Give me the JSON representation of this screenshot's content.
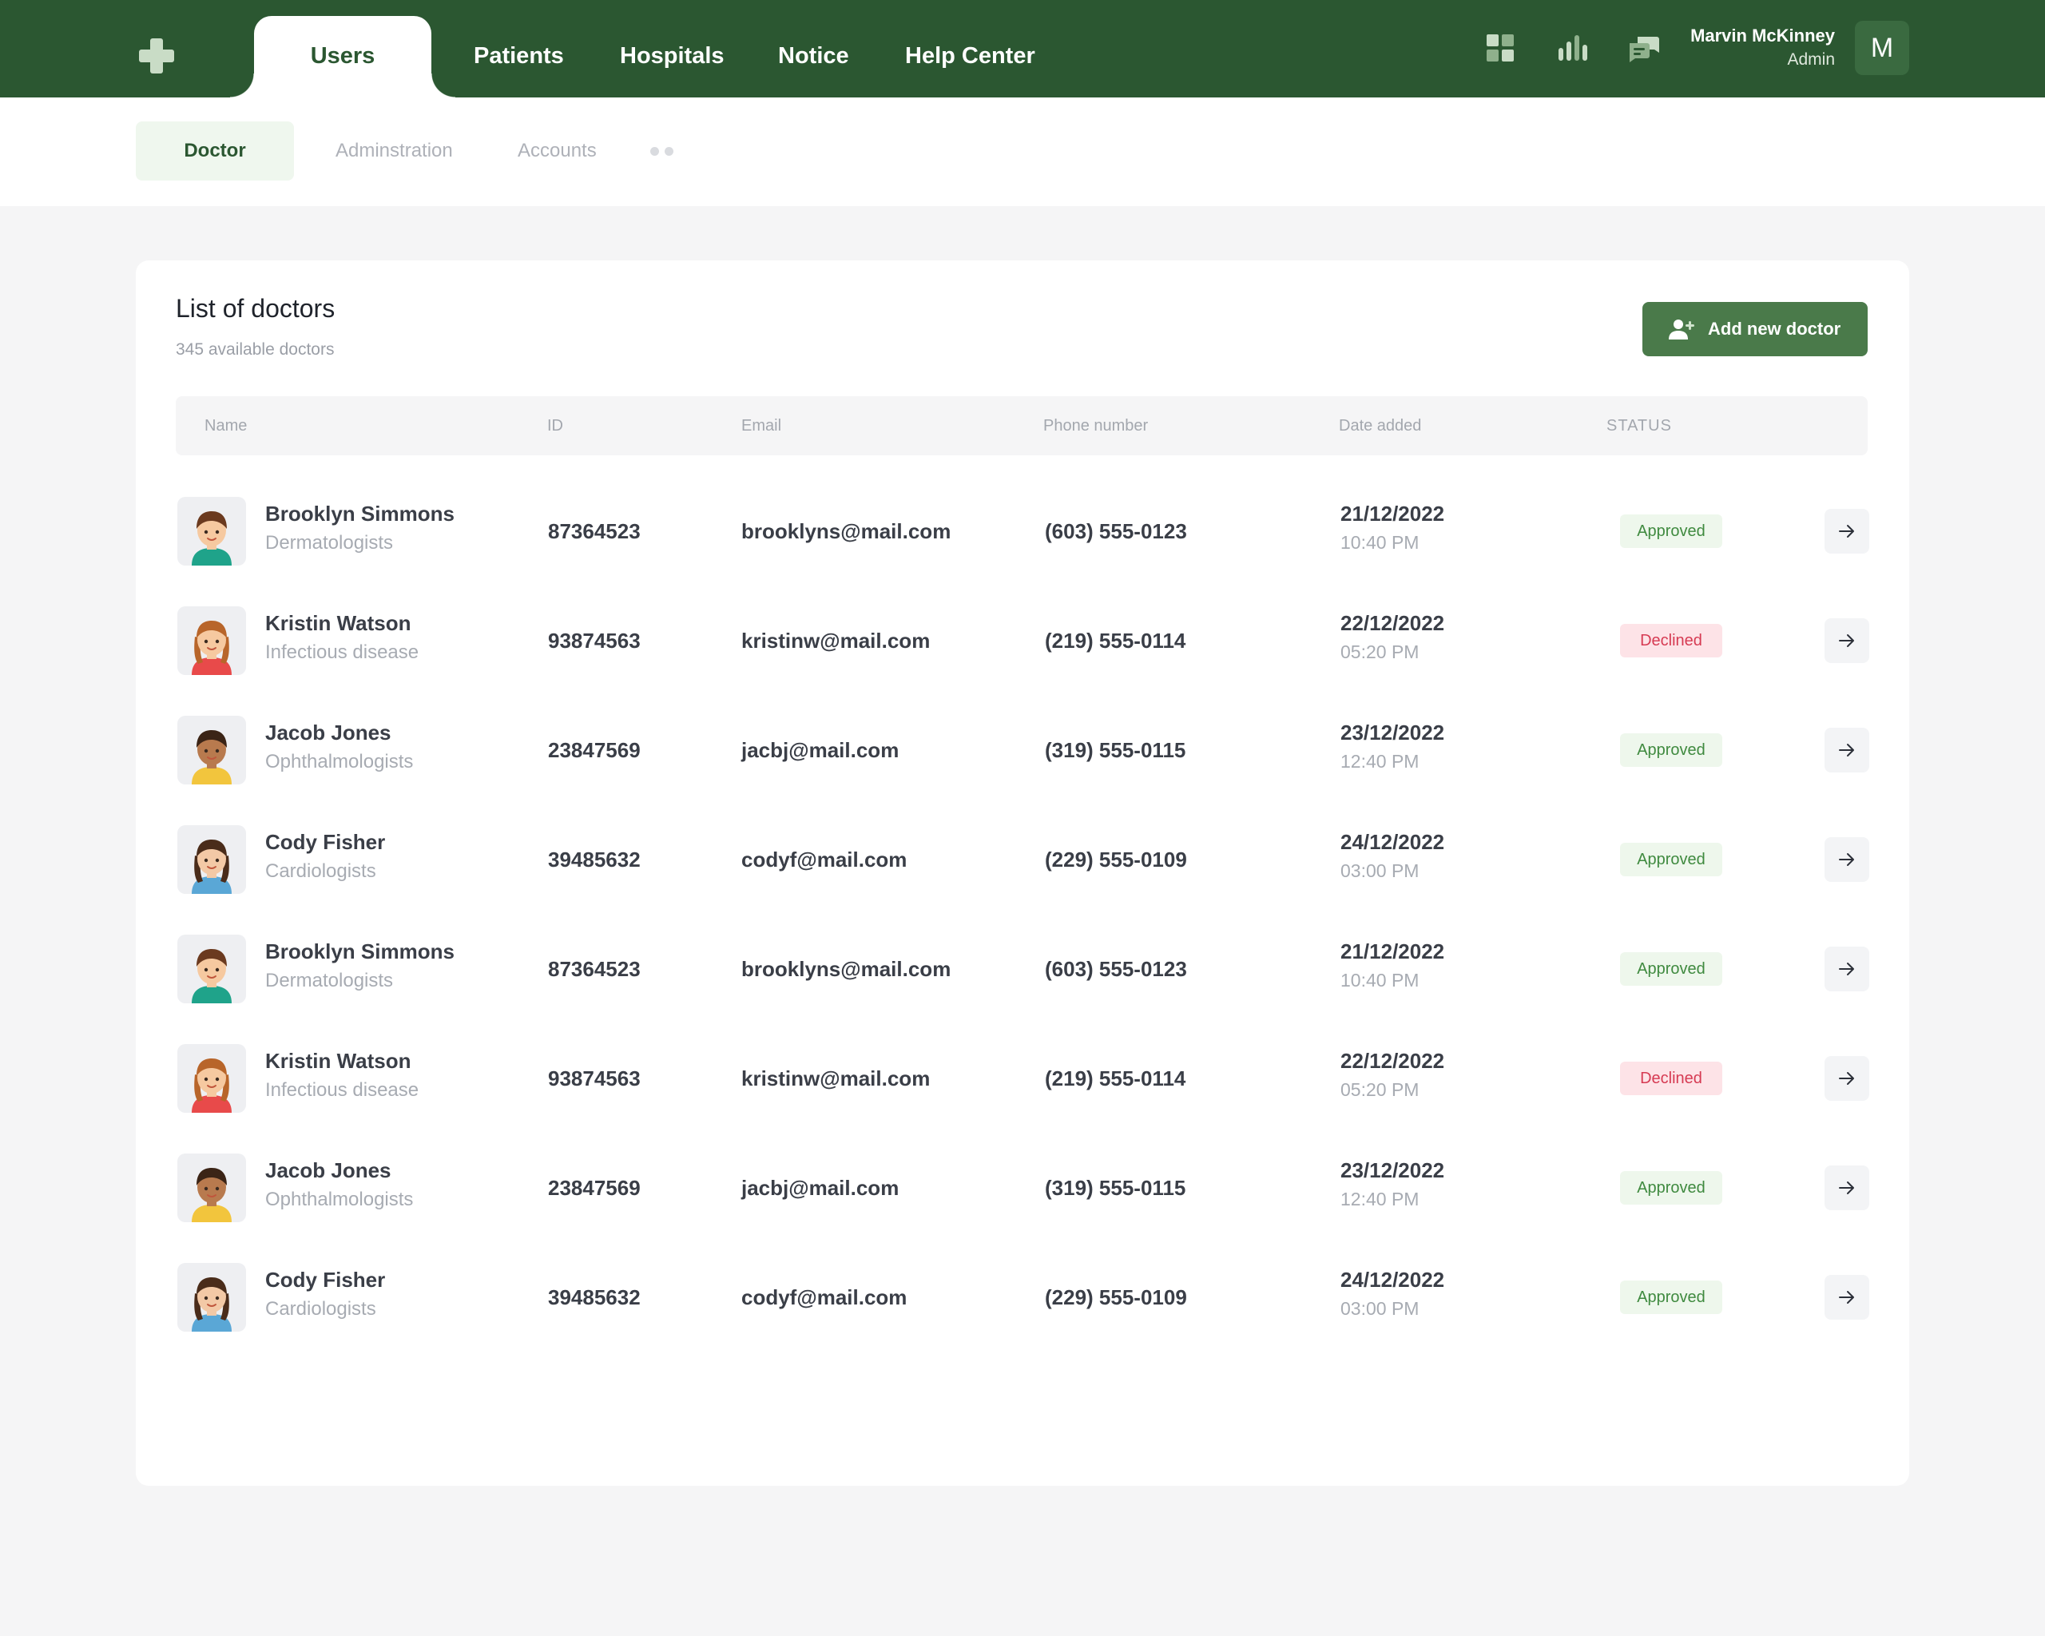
{
  "nav": {
    "tabs": [
      {
        "label": "Users",
        "active": true
      },
      {
        "label": "Patients"
      },
      {
        "label": "Hospitals"
      },
      {
        "label": "Notice"
      },
      {
        "label": "Help Center"
      }
    ],
    "icons": [
      "dashboard-icon",
      "bar-chart-icon",
      "chat-icon"
    ],
    "user": {
      "name": "Marvin McKinney",
      "role": "Admin",
      "initial": "M"
    }
  },
  "subnav": {
    "tabs": [
      {
        "label": "Doctor",
        "active": true
      },
      {
        "label": "Adminstration"
      },
      {
        "label": "Accounts"
      }
    ]
  },
  "card": {
    "title": "List of doctors",
    "subtitle": "345 available doctors",
    "add_button": "Add new doctor"
  },
  "table": {
    "headers": {
      "name": "Name",
      "id": "ID",
      "email": "Email",
      "phone": "Phone number",
      "date": "Date added",
      "status": "STATUS"
    },
    "rows": [
      {
        "name": "Brooklyn Simmons",
        "specialty": "Dermatologists",
        "id": "87364523",
        "email": "brooklyns@mail.com",
        "phone": "(603) 555-0123",
        "date": "21/12/2022",
        "time": "10:40 PM",
        "status": "Approved"
      },
      {
        "name": "Kristin Watson",
        "specialty": "Infectious disease",
        "id": "93874563",
        "email": "kristinw@mail.com",
        "phone": "(219) 555-0114",
        "date": "22/12/2022",
        "time": "05:20 PM",
        "status": "Declined"
      },
      {
        "name": "Jacob Jones",
        "specialty": "Ophthalmologists",
        "id": "23847569",
        "email": "jacbj@mail.com",
        "phone": "(319) 555-0115",
        "date": "23/12/2022",
        "time": "12:40 PM",
        "status": "Approved"
      },
      {
        "name": "Cody Fisher",
        "specialty": "Cardiologists",
        "id": "39485632",
        "email": "codyf@mail.com",
        "phone": "(229) 555-0109",
        "date": "24/12/2022",
        "time": "03:00 PM",
        "status": "Approved"
      },
      {
        "name": "Brooklyn Simmons",
        "specialty": "Dermatologists",
        "id": "87364523",
        "email": "brooklyns@mail.com",
        "phone": "(603) 555-0123",
        "date": "21/12/2022",
        "time": "10:40 PM",
        "status": "Approved"
      },
      {
        "name": "Kristin Watson",
        "specialty": "Infectious disease",
        "id": "93874563",
        "email": "kristinw@mail.com",
        "phone": "(219) 555-0114",
        "date": "22/12/2022",
        "time": "05:20 PM",
        "status": "Declined"
      },
      {
        "name": "Jacob Jones",
        "specialty": "Ophthalmologists",
        "id": "23847569",
        "email": "jacbj@mail.com",
        "phone": "(319) 555-0115",
        "date": "23/12/2022",
        "time": "12:40 PM",
        "status": "Approved"
      },
      {
        "name": "Cody Fisher",
        "specialty": "Cardiologists",
        "id": "39485632",
        "email": "codyf@mail.com",
        "phone": "(229) 555-0109",
        "date": "24/12/2022",
        "time": "03:00 PM",
        "status": "Approved"
      }
    ]
  },
  "colors": {
    "brand": "#2b5731",
    "button": "#4a7a4a",
    "approved": "#3f8a3f",
    "declined": "#d63a52"
  }
}
